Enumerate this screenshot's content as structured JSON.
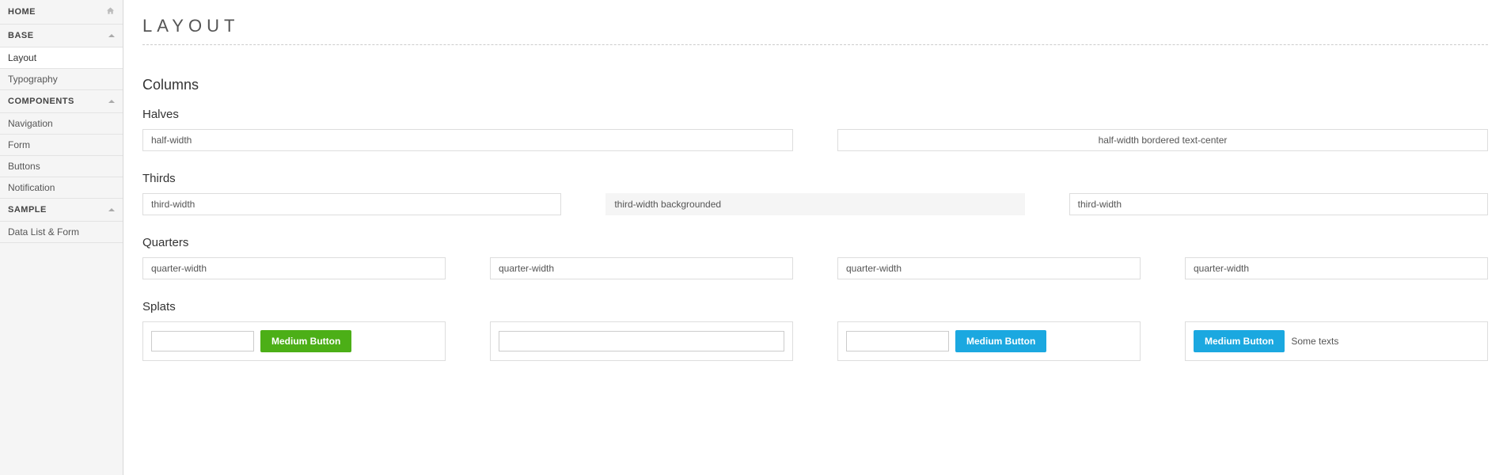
{
  "sidebar": {
    "home": {
      "label": "HOME"
    },
    "base": {
      "label": "BASE",
      "items": [
        "Layout",
        "Typography"
      ],
      "active_index": 0
    },
    "components": {
      "label": "COMPONENTS",
      "items": [
        "Navigation",
        "Form",
        "Buttons",
        "Notification"
      ]
    },
    "sample": {
      "label": "SAMPLE",
      "items": [
        "Data List & Form"
      ]
    }
  },
  "page": {
    "title": "LAYOUT",
    "columns_title": "Columns",
    "halves": {
      "title": "Halves",
      "left": "half-width",
      "right": "half-width bordered text-center"
    },
    "thirds": {
      "title": "Thirds",
      "a": "third-width",
      "b": "third-width backgrounded",
      "c": "third-width"
    },
    "quarters": {
      "title": "Quarters",
      "a": "quarter-width",
      "b": "quarter-width",
      "c": "quarter-width",
      "d": "quarter-width"
    },
    "splats": {
      "title": "Splats",
      "btn_green": "Medium Button",
      "btn_blue1": "Medium Button",
      "btn_blue2": "Medium Button",
      "text": "Some texts"
    }
  }
}
